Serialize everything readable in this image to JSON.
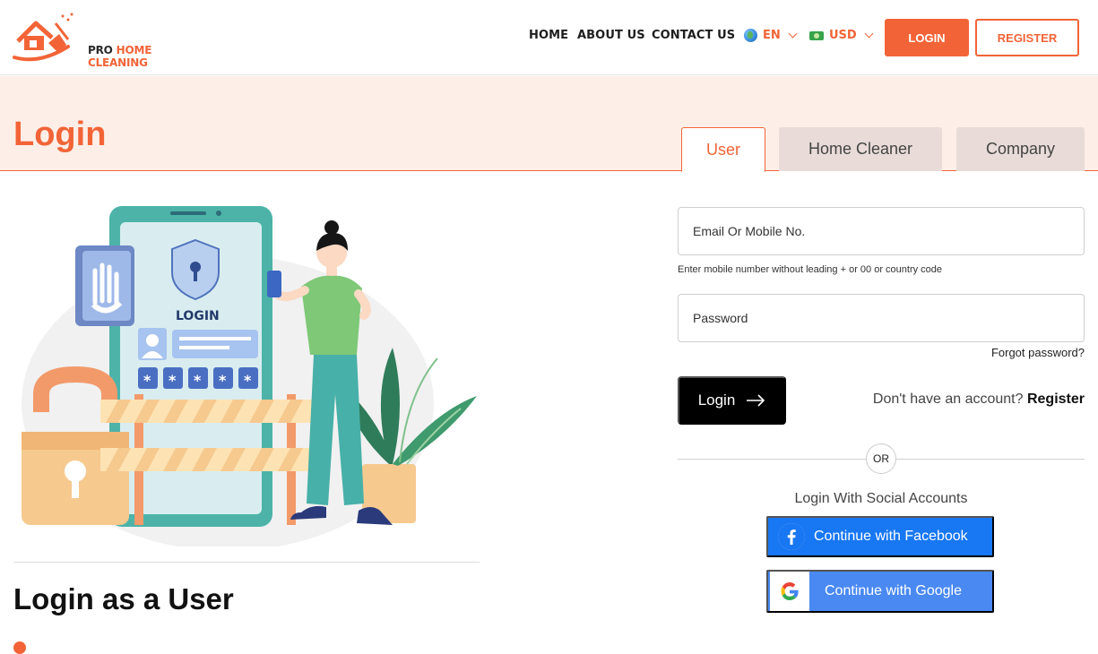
{
  "header": {
    "logo_pro": "PRO",
    "logo_rest": "HOME CLEANING",
    "nav": [
      "HOME",
      "ABOUT US",
      "CONTACT US"
    ],
    "language": "EN",
    "currency": "USD",
    "login_label": "LOGIN",
    "register_label": "REGISTER"
  },
  "banner": {
    "title": "Login",
    "tabs": [
      {
        "label": "User",
        "active": true
      },
      {
        "label": "Home Cleaner",
        "active": false
      },
      {
        "label": "Company",
        "active": false
      }
    ]
  },
  "illustration": {
    "screen_label": "LOGIN",
    "password_masks": [
      "*",
      "*",
      "*",
      "*",
      "*"
    ]
  },
  "left": {
    "section_title": "Login as a User"
  },
  "form": {
    "email_placeholder": "Email Or Mobile No.",
    "email_hint": "Enter mobile number without leading + or 00 or country code",
    "password_placeholder": "Password",
    "forgot_label": "Forgot password?",
    "login_button": "Login",
    "no_account_text": "Don't have an account?",
    "register_link": "Register",
    "or_label": "OR",
    "social_title": "Login With Social Accounts",
    "facebook_button": "Continue with Facebook",
    "google_button": "Continue with Google"
  },
  "colors": {
    "accent": "#f26437",
    "banner_bg": "#fdeee8",
    "facebook": "#1877f2",
    "google": "#4a89f2"
  }
}
